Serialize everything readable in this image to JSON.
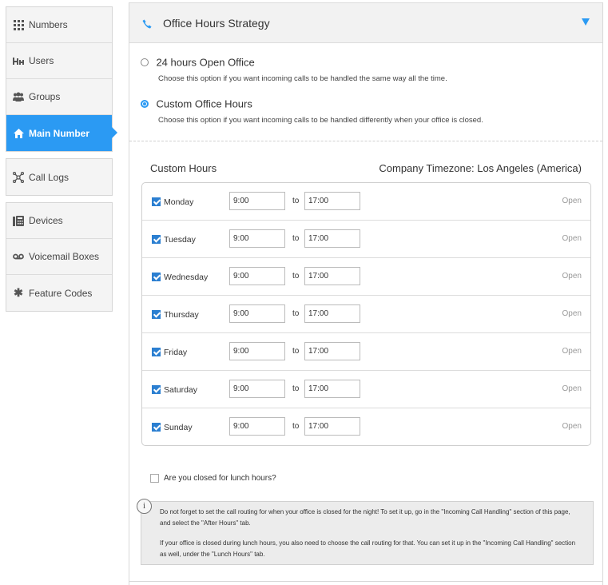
{
  "sidebar": {
    "groups": [
      [
        {
          "label": "Numbers",
          "icon": "grid-icon"
        },
        {
          "label": "Users",
          "icon": "users-icon"
        },
        {
          "label": "Groups",
          "icon": "group-icon"
        },
        {
          "label": "Main Number",
          "icon": "home-icon",
          "active": true
        }
      ],
      [
        {
          "label": "Call Logs",
          "icon": "network-icon"
        }
      ],
      [
        {
          "label": "Devices",
          "icon": "fax-icon"
        },
        {
          "label": "Voicemail Boxes",
          "icon": "voicemail-icon"
        },
        {
          "label": "Feature Codes",
          "icon": "asterisk-icon"
        }
      ]
    ]
  },
  "panel": {
    "title": "Office Hours Strategy",
    "accent_color": "#2b9af3"
  },
  "options": {
    "open24": {
      "label": "24 hours Open Office",
      "description": "Choose this option if you want incoming calls to be handled the same way all the time.",
      "selected": false
    },
    "custom": {
      "label": "Custom Office Hours",
      "description": "Choose this option if you want incoming calls to be handled differently when your office is closed.",
      "selected": true
    }
  },
  "custom_hours": {
    "title": "Custom Hours",
    "timezone": "Company Timezone: Los Angeles (America)",
    "to_label": "to",
    "days": [
      {
        "name": "Monday",
        "start": "9:00",
        "end": "17:00",
        "status": "Open",
        "checked": true
      },
      {
        "name": "Tuesday",
        "start": "9:00",
        "end": "17:00",
        "status": "Open",
        "checked": true
      },
      {
        "name": "Wednesday",
        "start": "9:00",
        "end": "17:00",
        "status": "Open",
        "checked": true
      },
      {
        "name": "Thursday",
        "start": "9:00",
        "end": "17:00",
        "status": "Open",
        "checked": true
      },
      {
        "name": "Friday",
        "start": "9:00",
        "end": "17:00",
        "status": "Open",
        "checked": true
      },
      {
        "name": "Saturday",
        "start": "9:00",
        "end": "17:00",
        "status": "Open",
        "checked": true
      },
      {
        "name": "Sunday",
        "start": "9:00",
        "end": "17:00",
        "status": "Open",
        "checked": true
      }
    ]
  },
  "lunch": {
    "label": "Are you closed for lunch hours?",
    "checked": false
  },
  "info": {
    "icon": "info-icon",
    "paragraph1": "Do not forget to set the call routing for when your office is closed for the night! To set it up, go in the \"Incoming Call Handling\" section of this page, and select the \"After Hours\" tab.",
    "paragraph2": "If your office is closed during lunch hours, you also need to choose the call routing for that. You can set it up in the \"Incoming Call Handling\" section as well, under the \"Lunch Hours\" tab."
  }
}
